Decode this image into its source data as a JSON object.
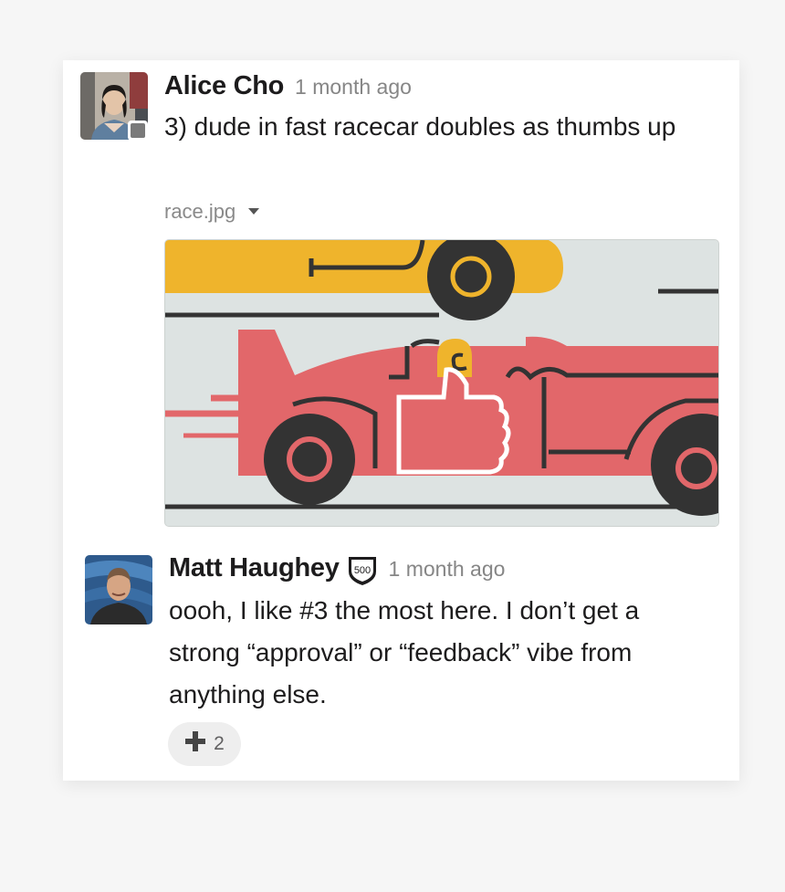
{
  "messages": [
    {
      "author": "Alice Cho",
      "time": "1 month ago",
      "text": "3) dude in fast racecar doubles as thumbs up",
      "attachment": {
        "filename": "race.jpg",
        "icon": "chevron-down-icon"
      },
      "presence": "away"
    },
    {
      "author": "Matt Haughey",
      "badge": "500",
      "time": "1 month ago",
      "text": "oooh, I like #3 the most here. I don’t get a strong “approval” or “feedback” vibe from anything else.",
      "reaction": {
        "icon": "heavy-plus-icon",
        "count": "2"
      }
    }
  ],
  "colors": {
    "car_red": "#e2676a",
    "car_yellow": "#efb42c",
    "track_bg": "#dde3e2",
    "outline": "#333333"
  }
}
